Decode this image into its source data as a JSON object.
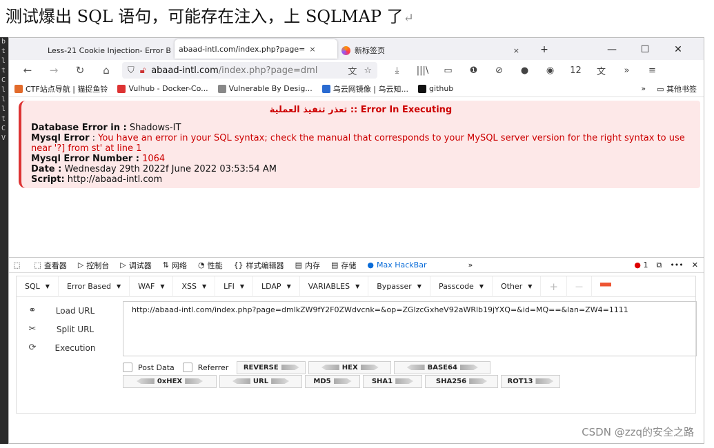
{
  "heading": "测试爆出 SQL 语句，可能存在注入，上 SQLMAP 了",
  "heading_return": "↵",
  "left_strip": [
    "b",
    "t",
    "l",
    "t",
    "C",
    "l",
    "l",
    "l",
    "t",
    "C",
    "V"
  ],
  "tabs": [
    {
      "label": "Less-21 Cookie Injection- Error B",
      "close": "×"
    },
    {
      "label": "abaad-intl.com/index.php?page=",
      "close": "×"
    },
    {
      "label": "新标签页",
      "close": "×"
    }
  ],
  "tab_controls": {
    "new_tab": "+",
    "minimize": "—",
    "maximize": "☐",
    "close": "✕"
  },
  "nav": {
    "back": "←",
    "forward": "→",
    "reload": "↻",
    "home": "⌂"
  },
  "url": {
    "host": "abaad-intl.com",
    "path": "/index.php?page=dml"
  },
  "toolbar_icons": [
    "⤓",
    "|||\\",
    "▭",
    "❶",
    "⊘",
    "●",
    "◉",
    "12",
    "文",
    "»",
    "≡"
  ],
  "bookmarks": [
    {
      "label": "CTF站点导航 | 猫捉鱼铃",
      "color": "#e26b2b"
    },
    {
      "label": "Vulhub - Docker-Co...",
      "color": "#d33"
    },
    {
      "label": "Vulnerable By Desig...",
      "color": "#888"
    },
    {
      "label": "乌云网镜像 | 乌云知...",
      "color": "#2a6bd1"
    },
    {
      "label": "github",
      "color": "#111"
    }
  ],
  "bookmarks_more": "»",
  "bookmarks_other": "其他书签",
  "error": {
    "title": "تعذر تنفيذ العملية :: Error In Executing",
    "db_label": "Database Error in :",
    "db_value": " Shadows-IT",
    "mysql_label": "Mysql Error",
    "mysql_sep": " : ",
    "mysql_value": "You have an error in your SQL syntax; check the manual that corresponds to your MySQL server version for the right syntax to use near '?] from st' at line 1",
    "num_label": "Mysql Error Number :",
    "num_value": " 1064",
    "date_label": "Date :",
    "date_value": " Wednesday 29th 2022f June 2022 03:53:54 AM",
    "script_label": "Script:",
    "script_value": " http://abaad-intl.com"
  },
  "devtools_tabs": [
    {
      "icon": "⬚",
      "label": "查看器"
    },
    {
      "icon": "▷",
      "label": "控制台"
    },
    {
      "icon": "▷",
      "label": "调试器"
    },
    {
      "icon": "⇅",
      "label": "网络"
    },
    {
      "icon": "◔",
      "label": "性能"
    },
    {
      "icon": "{}",
      "label": "样式编辑器"
    },
    {
      "icon": "▤",
      "label": "内存"
    },
    {
      "icon": "▤",
      "label": "存储"
    },
    {
      "icon": "●",
      "label": "Max HackBar"
    }
  ],
  "devtools_right": {
    "more": "»",
    "errors": "1",
    "dock": "⧉",
    "menu": "•••",
    "close": "✕"
  },
  "hackbar_menus": [
    "SQL",
    "Error Based",
    "WAF",
    "XSS",
    "LFI",
    "LDAP",
    "VARIABLES",
    "Bypasser",
    "Passcode",
    "Other"
  ],
  "hackbar_extra": {
    "add": "+",
    "remove": "—"
  },
  "hackbar_actions": [
    {
      "icon": "⚭",
      "label": "Load URL"
    },
    {
      "icon": "✂",
      "label": "Split URL"
    },
    {
      "icon": "⟳",
      "label": "Execution"
    }
  ],
  "hackbar_url": "http://abaad-intl.com/index.php?page=dmlkZW9fY2F0ZWdvcnk=&op=ZGlzcGxheV92aWRlb19jYXQ=&id=MQ==&lan=ZW4=1111",
  "checkboxes": {
    "post": "Post Data",
    "referrer": "Referrer"
  },
  "encode_buttons_row1": [
    "REVERSE",
    "HEX",
    "BASE64"
  ],
  "encode_buttons_row2": [
    "0xHEX",
    "URL",
    "MD5",
    "SHA1",
    "SHA256",
    "ROT13"
  ],
  "watermark": "CSDN @zzq的安全之路"
}
